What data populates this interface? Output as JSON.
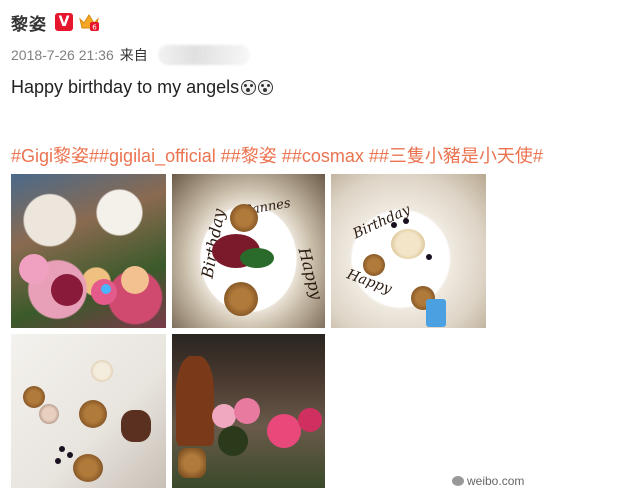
{
  "post": {
    "username": "黎姿",
    "verified_icon": "verified-v-icon",
    "vip_icon": "vip-crown-icon",
    "timestamp": "2018-7-26 21:36",
    "source_prefix": "来自",
    "text": "Happy birthday to my angels",
    "emojis": [
      "surprised-face-icon",
      "surprised-face-icon"
    ],
    "hashtags": [
      "#Gigi黎姿#",
      "#gigilai_official #",
      "#黎姿 #",
      "#cosmax #",
      "#三隻小豬是小天使#"
    ]
  },
  "photos": [
    {
      "name": "photo-flowers-table"
    },
    {
      "name": "photo-birthday-plate-cookies"
    },
    {
      "name": "photo-birthday-plate-dessert"
    },
    {
      "name": "photo-dessert-platter"
    },
    {
      "name": "photo-flower-arrangement-dog"
    }
  ],
  "watermark": "weibo.com",
  "colors": {
    "hashtag": "#eb7350",
    "verified": "#e6162d",
    "vip": "#f5a623"
  }
}
